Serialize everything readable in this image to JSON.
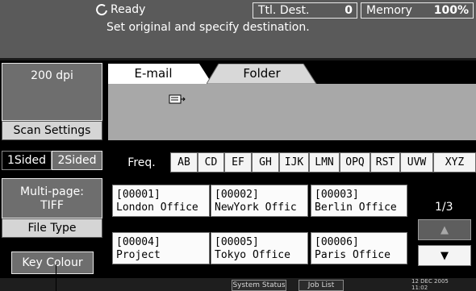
{
  "header": {
    "status_text": "Ready",
    "instruction": "Set original and specify destination.",
    "total_dest_label": "Ttl. Dest.",
    "total_dest_value": "0",
    "memory_label": "Memory",
    "memory_value": "100%"
  },
  "left_panel": {
    "resolution": "200 dpi",
    "scan_settings": "Scan Settings",
    "one_sided": "1Sided",
    "two_sided": "2Sided",
    "file_format_line1": "Multi-page:",
    "file_format_line2": "TIFF",
    "file_type": "File Type",
    "key_colour": "Key Colour"
  },
  "tabs": {
    "email": "E-mail",
    "folder": "Folder"
  },
  "index_tabs": [
    "Freq.",
    "AB",
    "CD",
    "EF",
    "GH",
    "IJK",
    "LMN",
    "OPQ",
    "RST",
    "UVW",
    "XYZ"
  ],
  "destinations": [
    {
      "code": "[00001]",
      "name": "London Office"
    },
    {
      "code": "[00002]",
      "name": "NewYork Offic"
    },
    {
      "code": "[00003]",
      "name": "Berlin Office"
    },
    {
      "code": "[00004]",
      "name": "Project"
    },
    {
      "code": "[00005]",
      "name": "Tokyo Office"
    },
    {
      "code": "[00006]",
      "name": "Paris Office"
    }
  ],
  "pager": {
    "page": "1/3",
    "up_glyph": "▲",
    "down_glyph": "▼"
  },
  "footer": {
    "system_status": "System Status",
    "job_list": "Job List",
    "date": "12 DEC  2005",
    "time": "11:02"
  },
  "colors": {
    "header_bg": "#5a5a5a",
    "panel_bg": "#000000",
    "selected_tab": "#ffffff",
    "field_bg": "#a8a8a8"
  }
}
